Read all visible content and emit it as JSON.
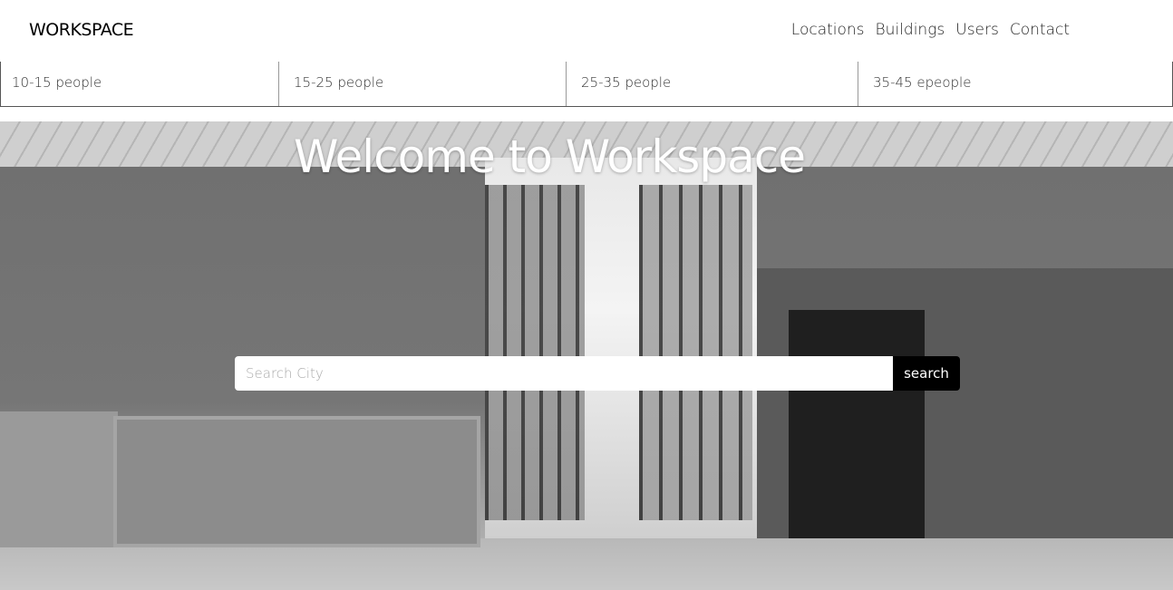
{
  "nav": {
    "brand": "WORKSPACE",
    "links": [
      "Locations",
      "Buildings",
      "Users",
      "Contact"
    ]
  },
  "sizes": [
    "10-15 people",
    "15-25 people",
    "25-35 people",
    "35-45 epeople"
  ],
  "hero": {
    "title": "Welcome to Workspace",
    "search_placeholder": "Search City",
    "search_button": "search"
  }
}
